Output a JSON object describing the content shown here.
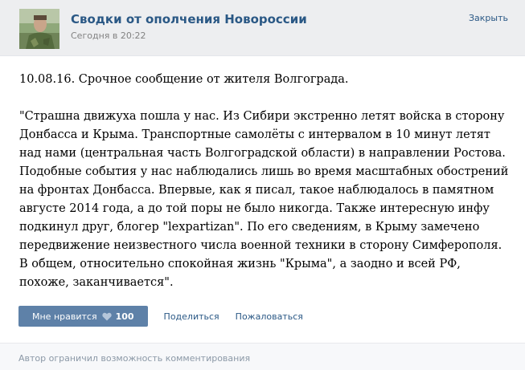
{
  "header": {
    "group_name": "Сводки от ополчения Новороссии",
    "time": "Сегодня в 20:22",
    "close_label": "Закрыть"
  },
  "post": {
    "date_line": "10.08.16. Срочное сообщение от жителя Волгограда.",
    "quote": "\"Страшна движуха пошла у нас. Из Сибири экстренно летят войска в сторону Донбасса и Крыма. Транспортные самолёты с интервалом в 10 минут летят над нами (центральная часть Волгоградской области) в направлении Ростова. Подобные события у нас наблюдались лишь во время масштабных обострений на фронтах Донбасса. Впервые, как я писал, такое наблюдалось в памятном августе 2014 года, а до той поры не было никогда. Также интересную инфу подкинул друг, блогер \"lexpartizan\". По его сведениям, в Крыму замечено передвижение неизвестного числа военной техники в сторону Симферополя. В общем, относительно спокойная жизнь \"Крыма\", а заодно и всей РФ, похоже, заканчивается\"."
  },
  "actions": {
    "like_label": "Мне нравится",
    "like_count": "100",
    "share_label": "Поделиться",
    "report_label": "Пожаловаться"
  },
  "footer": {
    "text": "Автор ограничил возможность комментирования"
  },
  "colors": {
    "link": "#2a5885",
    "like_button": "#5e81a8",
    "header_bg": "#edeef0",
    "footer_text": "#8c99a7"
  }
}
